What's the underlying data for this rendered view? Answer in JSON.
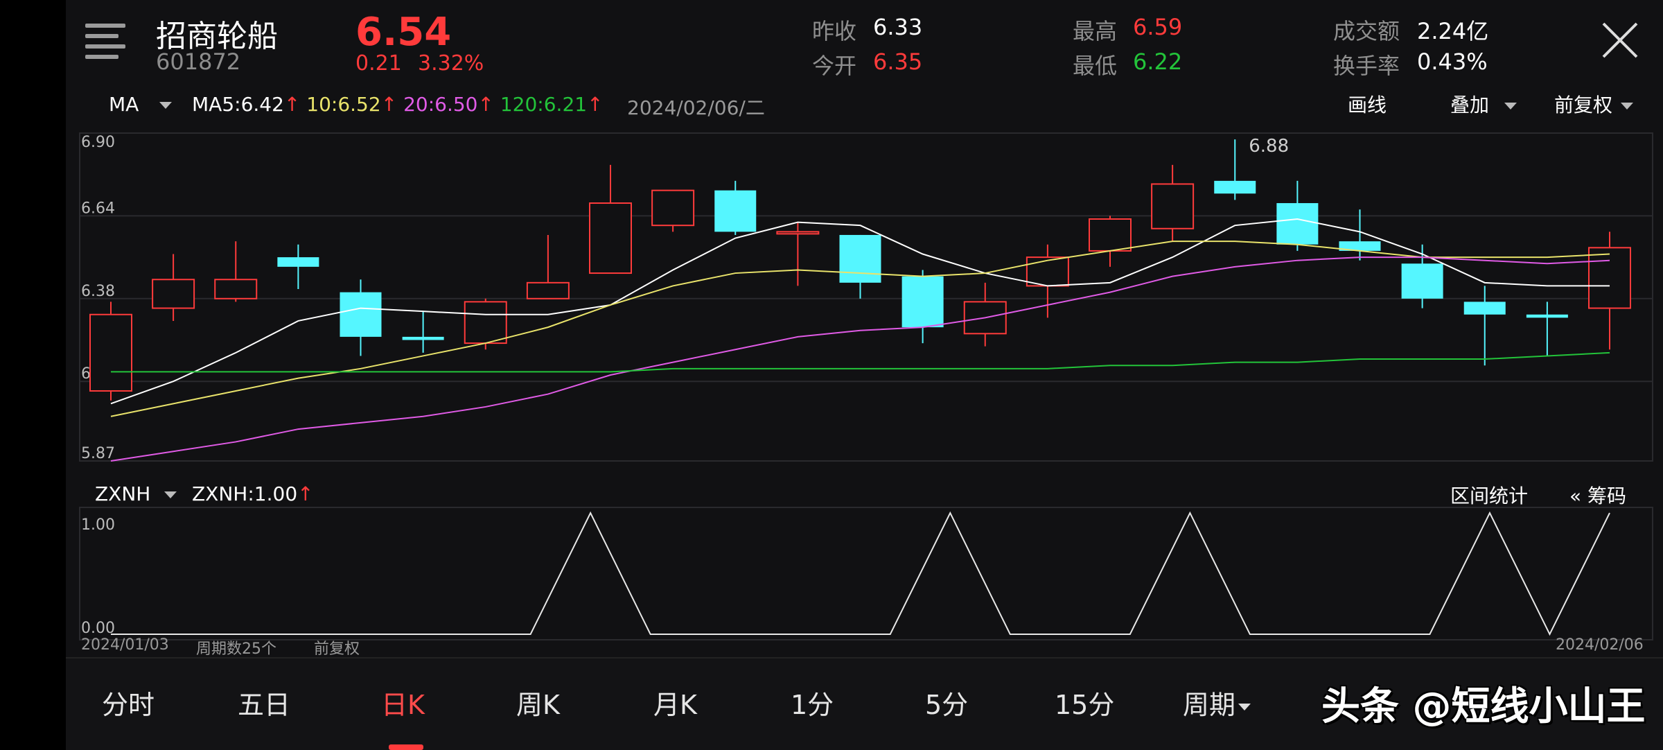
{
  "stock": {
    "name": "招商轮船",
    "code": "601872",
    "price": "6.54",
    "change": "0.21",
    "change_pct": "3.32%"
  },
  "stats": {
    "prev_close_label": "昨收",
    "prev_close": "6.33",
    "open_label": "今开",
    "open": "6.35",
    "high_label": "最高",
    "high": "6.59",
    "low_label": "最低",
    "low": "6.22",
    "volume_label": "成交额",
    "volume": "2.24亿",
    "turnover_label": "换手率",
    "turnover": "0.43%"
  },
  "ma_bar": {
    "selector": "MA",
    "ma5_label": "MA5:",
    "ma5": "6.42",
    "ma10_label": "10:",
    "ma10": "6.52",
    "ma20_label": "20:",
    "ma20": "6.50",
    "ma120_label": "120:",
    "ma120": "6.21",
    "arrow": "↑",
    "date": "2024/02/06/二",
    "draw_btn": "画线",
    "overlay_btn": "叠加",
    "adjust_btn": "前复权"
  },
  "indicator_bar": {
    "selector": "ZXNH",
    "value_label": "ZXNH:",
    "value": "1.00",
    "arrow": "↑",
    "interval_btn": "区间统计",
    "chips_btn": "« 筹码"
  },
  "footer_info": {
    "start_date": "2024/01/03",
    "period_count": "周期数25个",
    "adjust": "前复权",
    "end_date": "2024/02/06"
  },
  "tabs": [
    "分时",
    "五日",
    "日K",
    "周K",
    "月K",
    "1分",
    "5分",
    "15分",
    "周期"
  ],
  "active_tab": 2,
  "watermark": "头条 @短线小山王",
  "colors": {
    "up": "#ff3b3b",
    "down": "#55f6ff",
    "ma5": "#ffffff",
    "ma10": "#e9e36b",
    "ma20": "#e05be6",
    "ma120": "#23c43a"
  },
  "chart_data": [
    {
      "type": "candlestick",
      "title": "",
      "y_ticks": [
        "6.90",
        "6.64",
        "6.38",
        "6.12",
        "5.87"
      ],
      "ylim": [
        5.87,
        6.9
      ],
      "max_label": "6.88",
      "candles": [
        {
          "o": 6.09,
          "c": 6.33,
          "h": 6.37,
          "l": 6.06
        },
        {
          "o": 6.35,
          "c": 6.44,
          "h": 6.52,
          "l": 6.31
        },
        {
          "o": 6.38,
          "c": 6.44,
          "h": 6.56,
          "l": 6.37
        },
        {
          "o": 6.51,
          "c": 6.48,
          "h": 6.55,
          "l": 6.41
        },
        {
          "o": 6.4,
          "c": 6.26,
          "h": 6.44,
          "l": 6.2
        },
        {
          "o": 6.26,
          "c": 6.25,
          "h": 6.34,
          "l": 6.21
        },
        {
          "o": 6.24,
          "c": 6.37,
          "h": 6.38,
          "l": 6.22
        },
        {
          "o": 6.38,
          "c": 6.43,
          "h": 6.58,
          "l": 6.38
        },
        {
          "o": 6.46,
          "c": 6.68,
          "h": 6.8,
          "l": 6.46
        },
        {
          "o": 6.61,
          "c": 6.72,
          "h": 6.72,
          "l": 6.59
        },
        {
          "o": 6.72,
          "c": 6.59,
          "h": 6.75,
          "l": 6.58
        },
        {
          "o": 6.59,
          "c": 6.59,
          "h": 6.62,
          "l": 6.42
        },
        {
          "o": 6.58,
          "c": 6.43,
          "h": 6.58,
          "l": 6.38
        },
        {
          "o": 6.45,
          "c": 6.29,
          "h": 6.47,
          "l": 6.24
        },
        {
          "o": 6.27,
          "c": 6.37,
          "h": 6.43,
          "l": 6.23
        },
        {
          "o": 6.42,
          "c": 6.51,
          "h": 6.55,
          "l": 6.32
        },
        {
          "o": 6.53,
          "c": 6.63,
          "h": 6.64,
          "l": 6.48
        },
        {
          "o": 6.6,
          "c": 6.74,
          "h": 6.8,
          "l": 6.56
        },
        {
          "o": 6.75,
          "c": 6.71,
          "h": 6.88,
          "l": 6.69
        },
        {
          "o": 6.68,
          "c": 6.55,
          "h": 6.75,
          "l": 6.53
        },
        {
          "o": 6.56,
          "c": 6.53,
          "h": 6.66,
          "l": 6.5
        },
        {
          "o": 6.49,
          "c": 6.38,
          "h": 6.55,
          "l": 6.35
        },
        {
          "o": 6.37,
          "c": 6.33,
          "h": 6.42,
          "l": 6.17
        },
        {
          "o": 6.33,
          "c": 6.32,
          "h": 6.37,
          "l": 6.2
        },
        {
          "o": 6.35,
          "c": 6.54,
          "h": 6.59,
          "l": 6.22
        }
      ],
      "series": [
        {
          "values": [
            6.05,
            6.12,
            6.21,
            6.31,
            6.35,
            6.34,
            6.33,
            6.33,
            6.36,
            6.47,
            6.57,
            6.62,
            6.61,
            6.52,
            6.46,
            6.42,
            6.43,
            6.51,
            6.61,
            6.63,
            6.59,
            6.52,
            6.43,
            6.42,
            6.42
          ]
        },
        {
          "values": [
            6.01,
            6.05,
            6.09,
            6.13,
            6.16,
            6.2,
            6.24,
            6.29,
            6.36,
            6.42,
            6.46,
            6.47,
            6.46,
            6.45,
            6.46,
            6.5,
            6.53,
            6.56,
            6.56,
            6.55,
            6.53,
            6.51,
            6.51,
            6.51,
            6.52
          ]
        },
        {
          "values": [
            5.87,
            5.9,
            5.93,
            5.97,
            5.99,
            6.01,
            6.04,
            6.08,
            6.14,
            6.18,
            6.22,
            6.26,
            6.28,
            6.29,
            6.32,
            6.36,
            6.4,
            6.45,
            6.48,
            6.5,
            6.51,
            6.51,
            6.5,
            6.49,
            6.5
          ]
        },
        {
          "values": [
            6.15,
            6.15,
            6.15,
            6.15,
            6.15,
            6.15,
            6.15,
            6.15,
            6.15,
            6.16,
            6.16,
            6.16,
            6.16,
            6.16,
            6.16,
            6.16,
            6.17,
            6.17,
            6.18,
            6.18,
            6.19,
            6.19,
            6.19,
            6.2,
            6.21
          ]
        }
      ]
    },
    {
      "type": "line",
      "title": "",
      "y_ticks": [
        "1.00",
        "0.00"
      ],
      "ylim": [
        0,
        1
      ],
      "x_count": 25,
      "values": [
        0,
        0,
        0,
        0,
        0,
        0,
        0,
        0,
        1,
        0,
        0,
        0,
        0,
        0,
        1,
        0,
        0,
        0,
        1,
        0,
        0,
        0,
        0,
        1,
        0,
        1
      ]
    }
  ]
}
